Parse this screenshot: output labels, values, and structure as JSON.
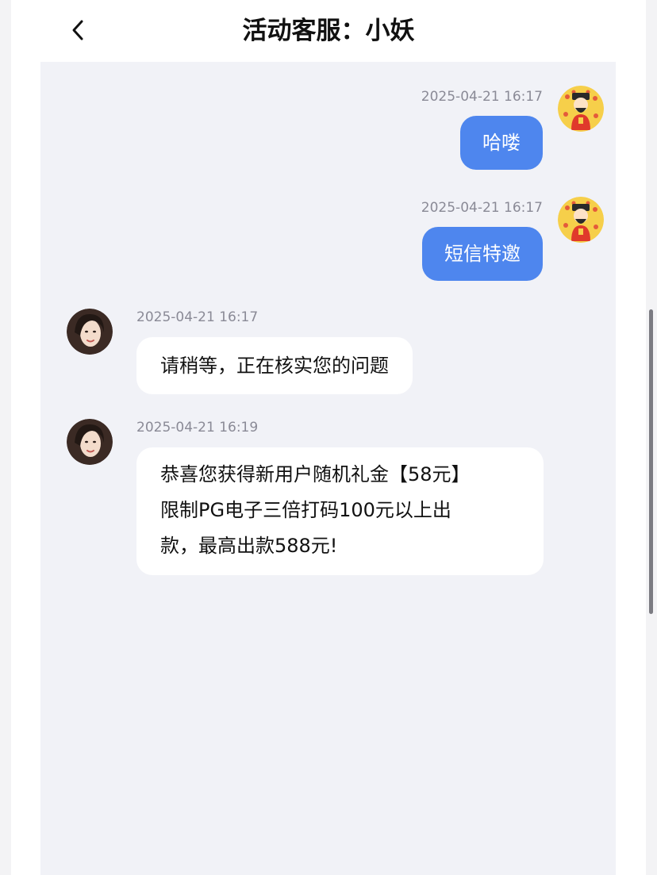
{
  "header": {
    "title": "活动客服：小妖"
  },
  "messages": [
    {
      "timestamp": "2025-04-21 16:17",
      "text": "哈喽"
    },
    {
      "timestamp": "2025-04-21 16:17",
      "text": "短信特邀"
    },
    {
      "timestamp": "2025-04-21 16:17",
      "text": "请稍等，正在核实您的问题"
    },
    {
      "timestamp": "2025-04-21 16:19",
      "lines": [
        "恭喜您获得新用户随机礼金【58元】",
        "限制PG电子三倍打码100元以上出",
        "款，最高出款588元!"
      ]
    }
  ],
  "colors": {
    "outgoing_bubble": "#4e86ee",
    "incoming_bubble": "#ffffff",
    "chat_background": "#f1f2f7"
  },
  "icons": {
    "back": "chevron-left-icon",
    "user_avatar": "god-of-wealth-avatar",
    "agent_avatar": "agent-avatar"
  }
}
